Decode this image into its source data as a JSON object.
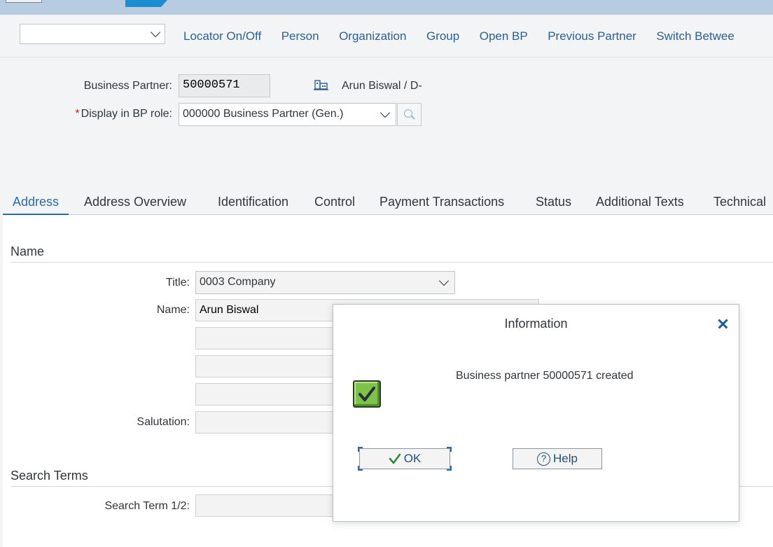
{
  "toolbar": {
    "select_value": "",
    "items": [
      "Locator On/Off",
      "Person",
      "Organization",
      "Group",
      "Open BP",
      "Previous Partner",
      "Switch Betwee"
    ]
  },
  "header": {
    "bp_label": "Business Partner:",
    "bp_value": "50000571",
    "bp_name": "Arun Biswal / D-",
    "role_label": "Display in BP role:",
    "role_value": "000000 Business Partner (Gen.)"
  },
  "tabs": [
    "Address",
    "Address Overview",
    "Identification",
    "Control",
    "Payment Transactions",
    "Status",
    "Additional Texts",
    "Technical"
  ],
  "name_section": {
    "title": "Name",
    "title_label": "Title:",
    "title_value": "0003 Company",
    "name_label": "Name:",
    "name_value": "Arun Biswal",
    "salutation_label": "Salutation:"
  },
  "search_section": {
    "title": "Search Terms",
    "term_label": "Search Term 1/2:"
  },
  "dialog": {
    "title": "Information",
    "message": "Business partner 50000571 created",
    "ok_label": "OK",
    "help_label": "Help"
  },
  "colors": {
    "accent": "#2a6bb0",
    "toolbar_link": "#2c5f93",
    "success": "#7dc24a"
  }
}
